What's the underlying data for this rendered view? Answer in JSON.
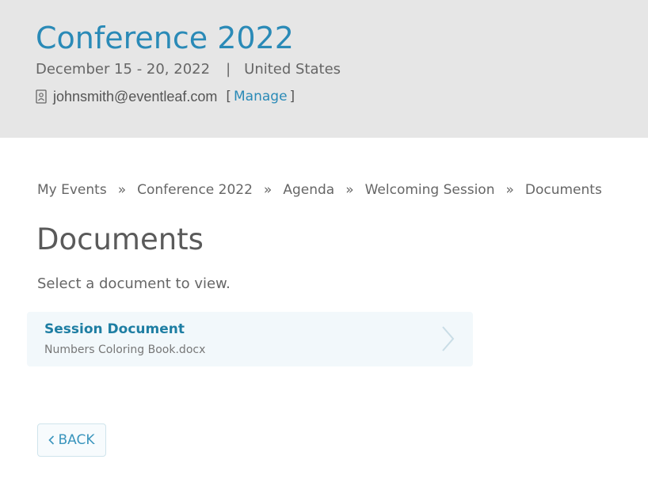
{
  "header": {
    "event_title": "Conference 2022",
    "dates": "December 15 - 20, 2022",
    "separator": "|",
    "location": "United States",
    "user_email": "johnsmith@eventleaf.com",
    "manage_open": "[",
    "manage_label": "Manage",
    "manage_close": "]",
    "icons": {
      "user": "user-badge-icon"
    }
  },
  "breadcrumb": {
    "items": [
      "My Events",
      "Conference 2022",
      "Agenda",
      "Welcoming Session",
      "Documents"
    ],
    "separator": "»"
  },
  "main": {
    "title": "Documents",
    "subtitle": "Select a document to view.",
    "documents": [
      {
        "title": "Session Document",
        "filename": "Numbers Coloring Book.docx"
      }
    ],
    "back_label": "BACK"
  },
  "colors": {
    "header_bg": "#e6e6e6",
    "accent": "#2a8ab7",
    "card_bg": "#f2f8fb",
    "doc_title": "#1e7ea3"
  }
}
